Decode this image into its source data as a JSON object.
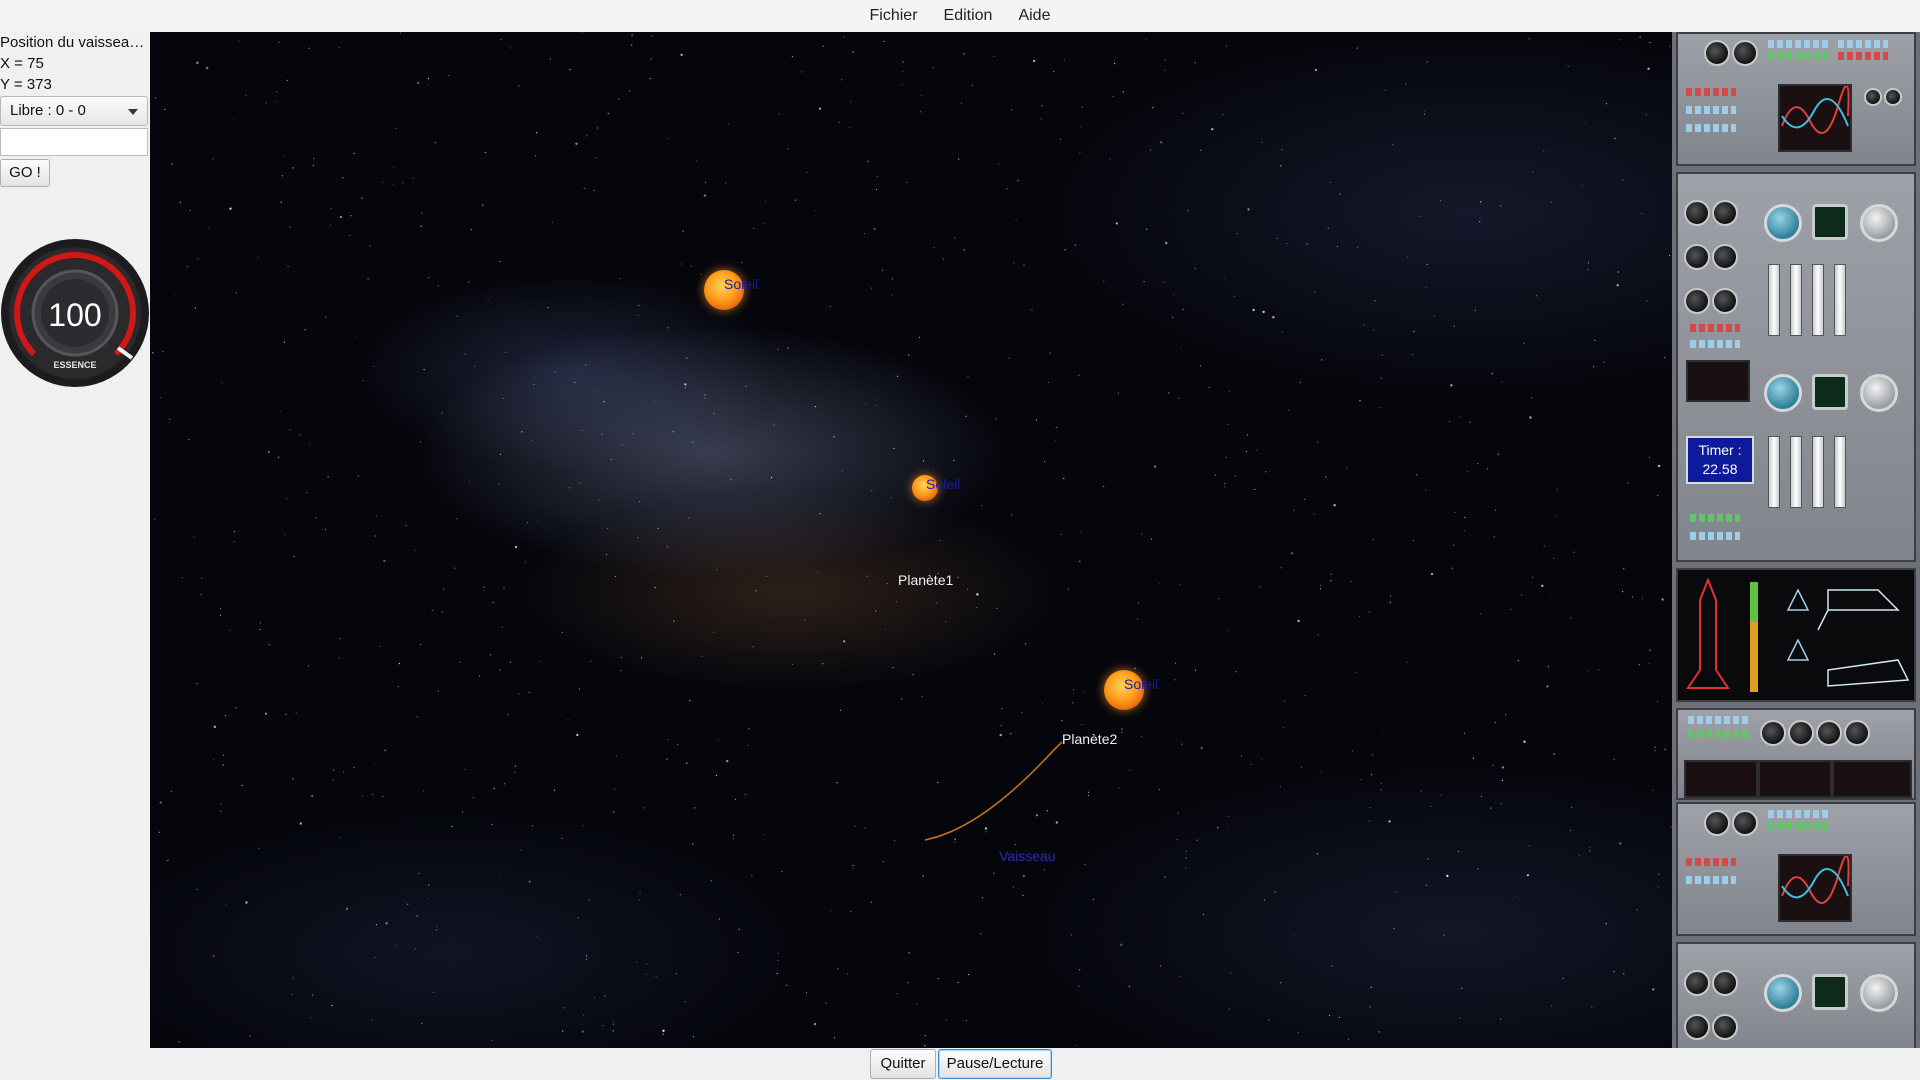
{
  "menubar": {
    "items": [
      "Fichier",
      "Edition",
      "Aide"
    ]
  },
  "left_panel": {
    "position_title": "Position du vaisseau ...",
    "x_text": "X = 75",
    "y_text": "Y = 373",
    "mode_select": "Libre : 0 - 0",
    "input_value": "",
    "go_button": "GO !",
    "fuel_gauge": {
      "value": "100",
      "label": "ESSENCE",
      "level_percent": 100,
      "accent": "#d01818"
    }
  },
  "scene": {
    "bodies": [
      {
        "kind": "sun",
        "label": "Soleil"
      },
      {
        "kind": "sun",
        "label": "Soleil"
      },
      {
        "kind": "planet",
        "label": "Planète1"
      },
      {
        "kind": "sun",
        "label": "Soleil"
      },
      {
        "kind": "planet",
        "label": "Planète2"
      },
      {
        "kind": "ship",
        "label": "Vaisseau"
      }
    ],
    "trajectory_color": "#c8741c"
  },
  "control_panel": {
    "timer_label": "Timer :",
    "timer_value": "22.58"
  },
  "bottom_bar": {
    "quit_button": "Quitter",
    "pause_button": "Pause/Lecture"
  },
  "colors": {
    "sun_label": "#1a1aa8",
    "planet_label": "#f2f2f2",
    "ship_label": "#2a2ab8",
    "timer_bg": "#0d1a9a"
  }
}
